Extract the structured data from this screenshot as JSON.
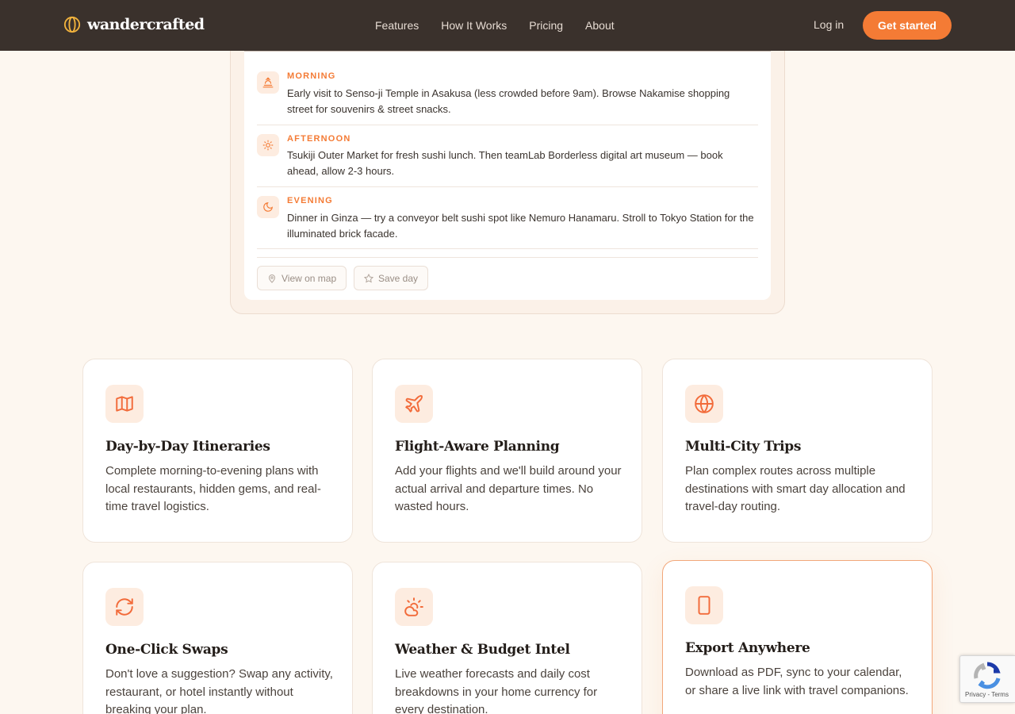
{
  "nav": {
    "brand": "wandercrafted",
    "links": [
      "Features",
      "How It Works",
      "Pricing",
      "About"
    ],
    "login": "Log in",
    "cta": "Get started"
  },
  "itinerary": {
    "slots": [
      {
        "label": "MORNING",
        "icon": "sunrise-icon",
        "text": "Early visit to Senso-ji Temple in Asakusa (less crowded before 9am). Browse Nakamise shopping street for souvenirs & street snacks."
      },
      {
        "label": "AFTERNOON",
        "icon": "sun-icon",
        "text": "Tsukiji Outer Market for fresh sushi lunch. Then teamLab Borderless digital art museum — book ahead, allow 2-3 hours."
      },
      {
        "label": "EVENING",
        "icon": "moon-icon",
        "text": "Dinner in Ginza — try a conveyor belt sushi spot like Nemuro Hanamaru. Stroll to Tokyo Station for the illuminated brick facade."
      }
    ],
    "view_map": "View on map",
    "save_day": "Save day"
  },
  "features": [
    {
      "title": "Day-by-Day Itineraries",
      "desc": "Complete morning-to-evening plans with local restaurants, hidden gems, and real-time travel logistics.",
      "icon": "map-icon"
    },
    {
      "title": "Flight-Aware Planning",
      "desc": "Add your flights and we'll build around your actual arrival and departure times. No wasted hours.",
      "icon": "plane-icon"
    },
    {
      "title": "Multi-City Trips",
      "desc": "Plan complex routes across multiple destinations with smart day allocation and travel-day routing.",
      "icon": "globe-icon"
    },
    {
      "title": "One-Click Swaps",
      "desc": "Don't love a suggestion? Swap any activity, restaurant, or hotel instantly without breaking your plan.",
      "icon": "refresh-icon"
    },
    {
      "title": "Weather & Budget Intel",
      "desc": "Live weather forecasts and daily cost breakdowns in your home currency for every destination.",
      "icon": "weather-icon"
    },
    {
      "title": "Export Anywhere",
      "desc": "Download as PDF, sync to your calendar, or share a live link with travel companions.",
      "icon": "tablet-icon"
    }
  ],
  "recaptcha": {
    "footer": "Privacy - Terms"
  },
  "colors": {
    "accent": "#f47b35",
    "nav_bg": "#3a312c",
    "page_bg": "#fdf7f0"
  }
}
